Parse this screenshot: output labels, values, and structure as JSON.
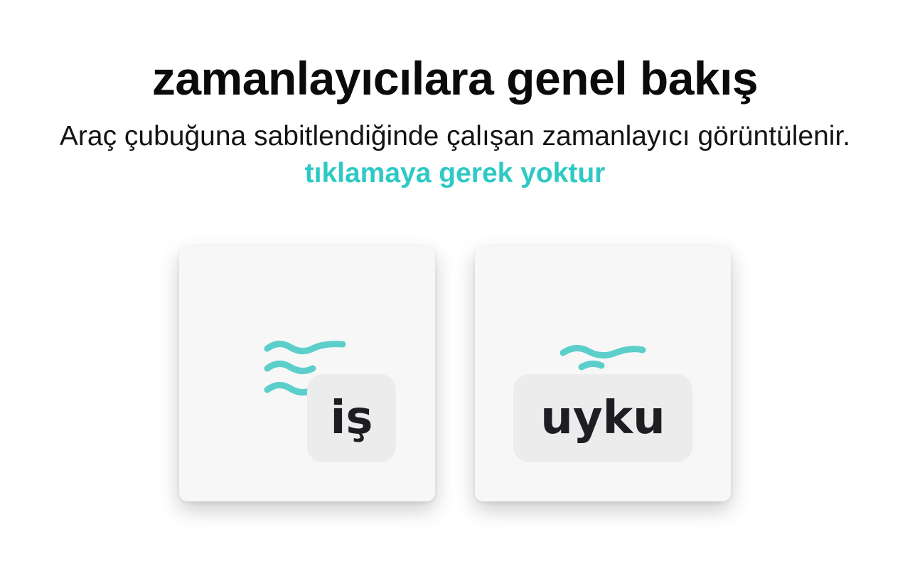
{
  "header": {
    "title": "zamanlayıcılara genel bakış",
    "subtitle": "Araç çubuğuna sabitlendiğinde çalışan zamanlayıcı görüntülenir.",
    "subtitle_accent": "tıklamaya gerek yoktur"
  },
  "cards": [
    {
      "label": "iş",
      "icon": "waves-icon"
    },
    {
      "label": "uyku",
      "icon": "wave-icon"
    }
  ],
  "colors": {
    "accent": "#2ec9c4",
    "wave": "#5ccfcb",
    "card_bg": "#f8f7f8",
    "badge_bg": "#ececed",
    "text": "#0b0b0b"
  }
}
